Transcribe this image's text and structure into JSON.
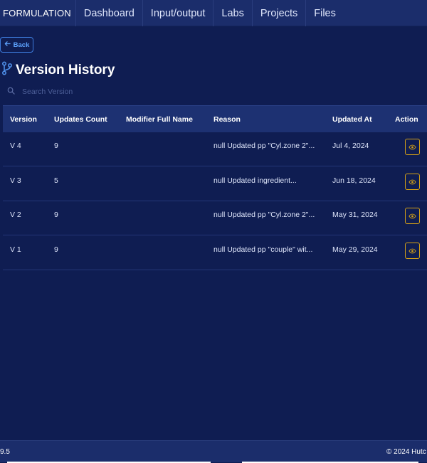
{
  "nav": {
    "brand": "FORMULATION",
    "items": [
      "Dashboard",
      "Input/output",
      "Labs",
      "Projects",
      "Files"
    ]
  },
  "back_label": "Back",
  "title": "Version History",
  "search": {
    "placeholder": "Search Version",
    "value": ""
  },
  "table": {
    "headers": [
      "Version",
      "Updates Count",
      "Modifier Full Name",
      "Reason",
      "Updated At",
      "Action"
    ],
    "rows": [
      {
        "version": "V 4",
        "count": "9",
        "modifier": "",
        "reason": "null Updated pp \"Cyl.zone 2\"...",
        "updated_at": "Jul 4, 2024"
      },
      {
        "version": "V 3",
        "count": "5",
        "modifier": "",
        "reason": "null Updated ingredient...",
        "updated_at": "Jun 18, 2024"
      },
      {
        "version": "V 2",
        "count": "9",
        "modifier": "",
        "reason": "null Updated pp \"Cyl.zone 2\"...",
        "updated_at": "May 31, 2024"
      },
      {
        "version": "V 1",
        "count": "9",
        "modifier": "",
        "reason": "null Updated pp \"couple\" wit...",
        "updated_at": "May 29, 2024"
      }
    ]
  },
  "footer": {
    "version": "9.5",
    "copyright": "© 2024 Hutc"
  },
  "colors": {
    "background": "#0f1d52",
    "nav_bg": "#1b2d6b",
    "accent_blue": "#3d7bdc",
    "action_gold": "#d4a017"
  }
}
